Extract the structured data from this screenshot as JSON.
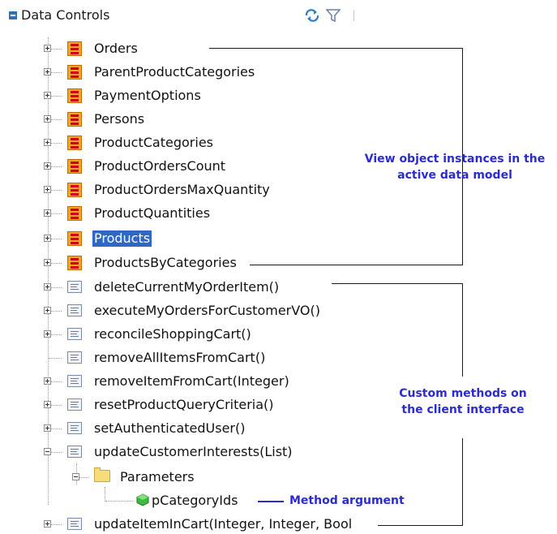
{
  "header": {
    "title": "Data Controls"
  },
  "view_objects": [
    "Orders",
    "ParentProductCategories",
    "PaymentOptions",
    "Persons",
    "ProductCategories",
    "ProductOrdersCount",
    "ProductOrdersMaxQuantity",
    "ProductQuantities",
    "Products",
    "ProductsByCategories"
  ],
  "selected_item": "Products",
  "methods": [
    "deleteCurrentMyOrderItem()",
    "executeMyOrdersForCustomerVO()",
    "reconcileShoppingCart()",
    "removeAllItemsFromCart()",
    "removeItemFromCart(Integer)",
    "resetProductQueryCriteria()",
    "setAuthenticatedUser()",
    "updateCustomerInterests(List)"
  ],
  "parameters_folder": "Parameters",
  "argument": "pCategoryIds",
  "last_method": "updateItemInCart(Integer, Integer, Bool",
  "annotations": {
    "view_objects_line1": "View object instances in the",
    "view_objects_line2": "active data model",
    "methods_line1": "Custom methods on",
    "methods_line2": "the client interface",
    "method_argument": "Method argument"
  },
  "icons": {
    "header_refresh": "refresh-icon",
    "header_filter": "filter-icon",
    "view_object": "view-object-icon",
    "method": "method-icon",
    "folder": "folder-icon",
    "argument": "argument-icon"
  }
}
